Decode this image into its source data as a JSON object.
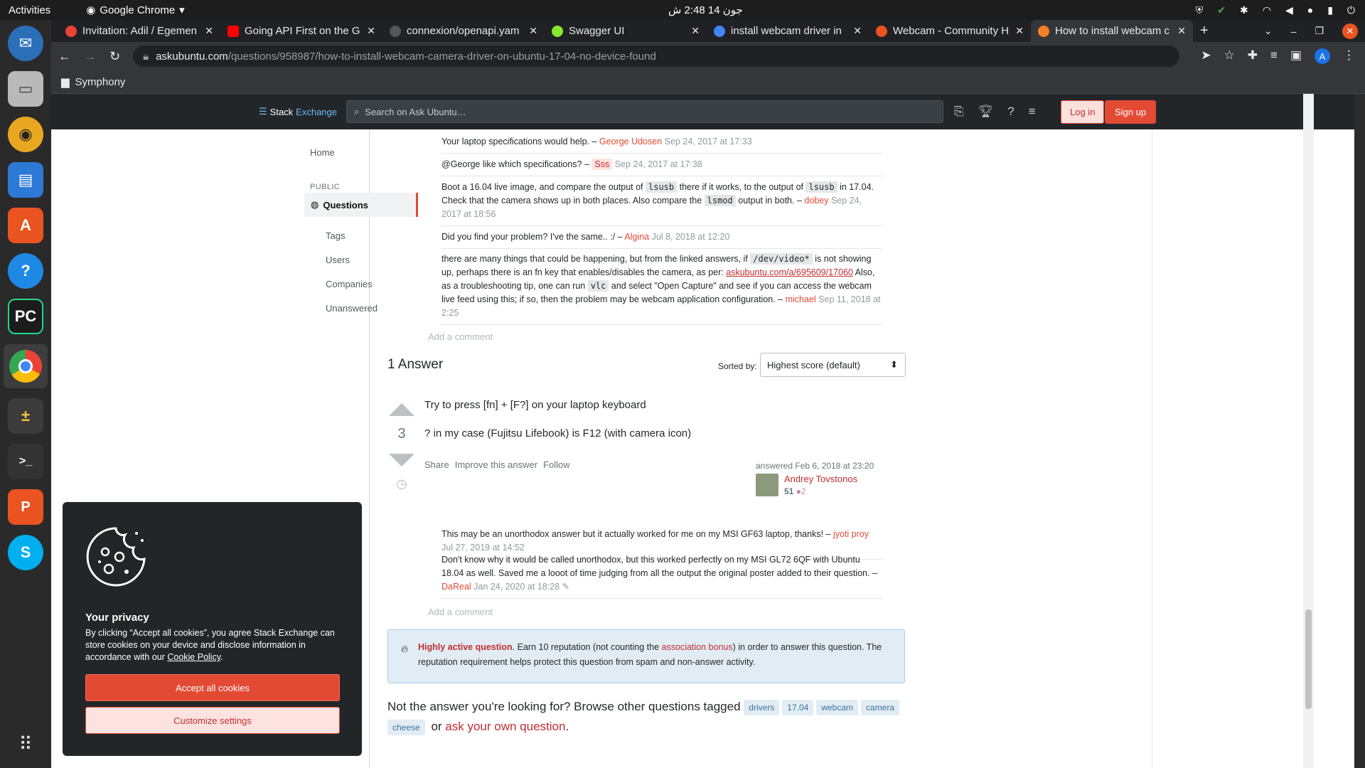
{
  "os": {
    "activities": "Activities",
    "app_name": "Google Chrome",
    "clock": "جون 14  2:48 ش"
  },
  "tabs": [
    {
      "title": "Invitation: Adil / Egemen",
      "color": "#ea4335"
    },
    {
      "title": "Going API First on the G",
      "color": "#ff0000"
    },
    {
      "title": "connexion/openapi.yam",
      "color": "#555555"
    },
    {
      "title": "Swagger UI",
      "color": "#85ea2d"
    },
    {
      "title": "install webcam driver in",
      "color": "#4285f4"
    },
    {
      "title": "Webcam - Community H",
      "color": "#e95420"
    },
    {
      "title": "How to install webcam c",
      "color": "#f48024"
    }
  ],
  "address": {
    "domain": "askubuntu.com",
    "path": "/questions/958987/how-to-install-webcam-camera-driver-on-ubuntu-17-04-no-device-found"
  },
  "bookmarks": {
    "folder": "Symphony"
  },
  "topbar": {
    "logo_stack": "Stack",
    "logo_exchange": "Exchange",
    "search_placeholder": "Search on Ask Ubuntu…",
    "login": "Log in",
    "signup": "Sign up"
  },
  "leftnav": {
    "home": "Home",
    "public": "PUBLIC",
    "questions": "Questions",
    "tags": "Tags",
    "users": "Users",
    "companies": "Companies",
    "unanswered": "Unanswered"
  },
  "comments": [
    {
      "pre": "Your laptop specifications would help. – ",
      "user": "George Udosen",
      "date": "Sep 24, 2017 at 17:33"
    },
    {
      "pre": "@George like which specifications? – ",
      "user": "Sss",
      "date": "Sep 24, 2017 at 17:38"
    },
    {
      "t1": "Boot a 16.04 live image, and compare the output of ",
      "c1": "lsusb",
      "t2": " there if it works, to the output of ",
      "c2": "lsusb",
      "t3": " in 17.04. Check that the camera shows up in both places. Also compare the ",
      "c3": "lsmod",
      "t4": " output in both. – ",
      "user": "dobey",
      "date": "Sep 24, 2017 at 18:56"
    },
    {
      "pre": "Did you find your problem? I've the same.. :/ – ",
      "user": "Algina",
      "date": "Jul 8, 2018 at 12:20"
    },
    {
      "t1": "there are many things that could be happening, but from the linked answers, if ",
      "c1": "/dev/video*",
      "t2": " is not showing up, perhaps there is an fn key that enables/disables the camera, as per: ",
      "link": "askubuntu.com/a/695609/17060",
      "t3": " Also, as a troubleshooting tip, one can run ",
      "c2": "vlc",
      "t4": " and select \"Open Capture\" and see if you can access the webcam live feed using this; if so, then the problem may be webcam application configuration. – ",
      "user": "michael",
      "date": "Sep 11, 2018 at 2:25"
    }
  ],
  "add_comment": "Add a comment",
  "answers_header": "1 Answer",
  "sorted_by": "Sorted by:",
  "sort_value": "Highest score (default)",
  "answer": {
    "score": "3",
    "p1": "Try to press [fn] + [F?] on your laptop keyboard",
    "p2": "? in my case (Fujitsu Lifebook) is F12 (with camera icon)",
    "share": "Share",
    "improve": "Improve this answer",
    "follow": "Follow",
    "answered": "answered Feb 6, 2018 at 23:20",
    "user": "Andrey Tovstonos",
    "rep": "51",
    "bronze": "●2"
  },
  "answer_comments": [
    {
      "pre": "This may be an unorthodox answer but it actually worked for me on my MSI GF63 laptop, thanks! – ",
      "user": "jyoti proy",
      "date": "Jul 27, 2019 at 14:52"
    },
    {
      "pre": "Don't know why it would be called unorthodox, but this worked perfectly on my MSI GL72 6QF with Ubuntu 18.04 as well. Saved me a looot of time judging from all the output the original poster added to their question. – ",
      "user": "DaReal",
      "date": "Jan 24, 2020 at 18:28"
    }
  ],
  "notice": {
    "strong": "Highly active question",
    "t1": ". Earn 10 reputation (not counting the ",
    "link": "association bonus",
    "t2": ") in order to answer this question. The reputation requirement helps protect this question from spam and non-answer activity."
  },
  "footer": {
    "text": "Not the answer you're looking for? Browse other questions tagged",
    "tags": [
      "drivers",
      "17.04",
      "webcam",
      "camera",
      "cheese"
    ],
    "or": "or",
    "ask": "ask your own question",
    "dot": "."
  },
  "cookie": {
    "title": "Your privacy",
    "text": "By clicking “Accept all cookies”, you agree Stack Exchange can store cookies on your device and disclose information in accordance with our ",
    "policy": "Cookie Policy",
    "policy_end": ".",
    "accept": "Accept all cookies",
    "customize": "Customize settings"
  }
}
